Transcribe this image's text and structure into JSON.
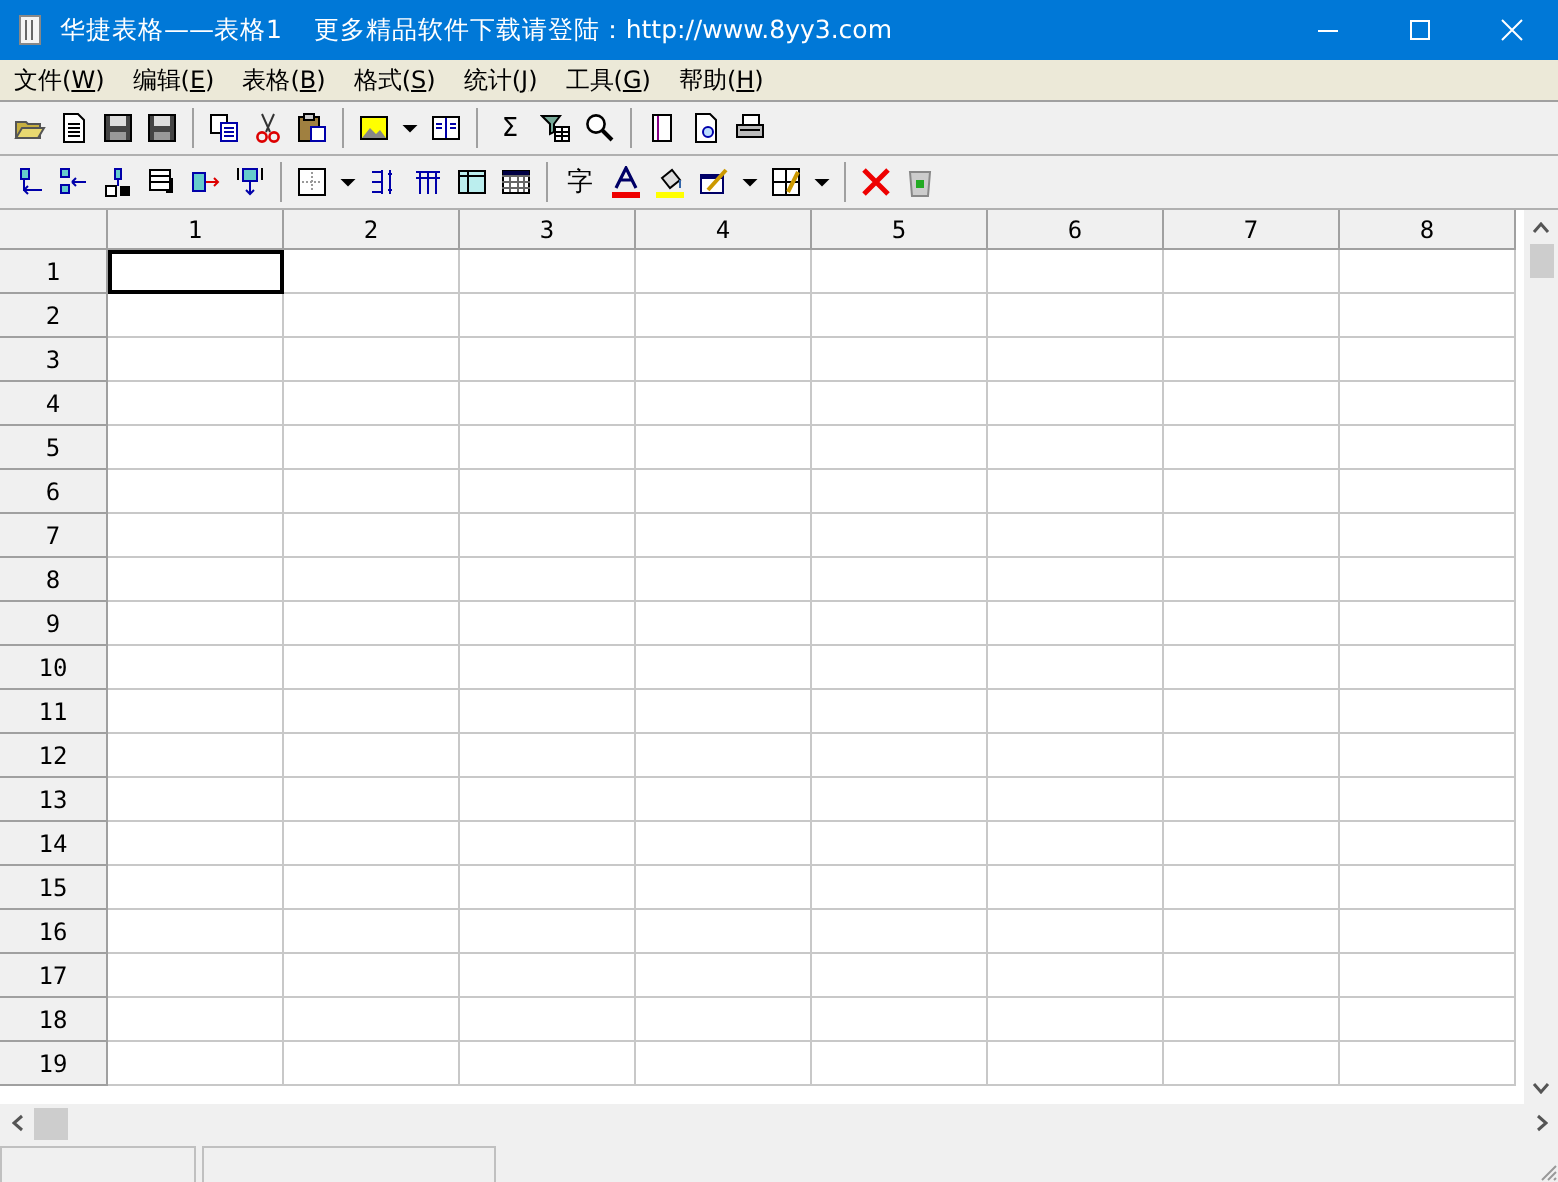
{
  "window": {
    "title": "华捷表格——表格1    更多精品软件下载请登陆：http://www.8yy3.com"
  },
  "menu": [
    {
      "label": "文件(W)"
    },
    {
      "label": "编辑(E)"
    },
    {
      "label": "表格(B)"
    },
    {
      "label": "格式(S)"
    },
    {
      "label": "统计(J)"
    },
    {
      "label": "工具(G)"
    },
    {
      "label": "帮助(H)"
    }
  ],
  "toolbar_glyphs": {
    "sum": "Σ",
    "character": "字"
  },
  "table": {
    "columns": [
      {
        "label": "1"
      },
      {
        "label": "2"
      },
      {
        "label": "3"
      },
      {
        "label": "4"
      },
      {
        "label": "5"
      },
      {
        "label": "6"
      },
      {
        "label": "7"
      },
      {
        "label": "8"
      }
    ],
    "rows": [
      {
        "label": "1",
        "cells": [
          {
            "selected": true
          },
          {
            "selected": false
          },
          {
            "selected": false
          },
          {
            "selected": false
          },
          {
            "selected": false
          },
          {
            "selected": false
          },
          {
            "selected": false
          },
          {
            "selected": false
          }
        ]
      },
      {
        "label": "2",
        "cells": [
          {
            "selected": false
          },
          {
            "selected": false
          },
          {
            "selected": false
          },
          {
            "selected": false
          },
          {
            "selected": false
          },
          {
            "selected": false
          },
          {
            "selected": false
          },
          {
            "selected": false
          }
        ]
      },
      {
        "label": "3",
        "cells": [
          {
            "selected": false
          },
          {
            "selected": false
          },
          {
            "selected": false
          },
          {
            "selected": false
          },
          {
            "selected": false
          },
          {
            "selected": false
          },
          {
            "selected": false
          },
          {
            "selected": false
          }
        ]
      },
      {
        "label": "4",
        "cells": [
          {
            "selected": false
          },
          {
            "selected": false
          },
          {
            "selected": false
          },
          {
            "selected": false
          },
          {
            "selected": false
          },
          {
            "selected": false
          },
          {
            "selected": false
          },
          {
            "selected": false
          }
        ]
      },
      {
        "label": "5",
        "cells": [
          {
            "selected": false
          },
          {
            "selected": false
          },
          {
            "selected": false
          },
          {
            "selected": false
          },
          {
            "selected": false
          },
          {
            "selected": false
          },
          {
            "selected": false
          },
          {
            "selected": false
          }
        ]
      },
      {
        "label": "6",
        "cells": [
          {
            "selected": false
          },
          {
            "selected": false
          },
          {
            "selected": false
          },
          {
            "selected": false
          },
          {
            "selected": false
          },
          {
            "selected": false
          },
          {
            "selected": false
          },
          {
            "selected": false
          }
        ]
      },
      {
        "label": "7",
        "cells": [
          {
            "selected": false
          },
          {
            "selected": false
          },
          {
            "selected": false
          },
          {
            "selected": false
          },
          {
            "selected": false
          },
          {
            "selected": false
          },
          {
            "selected": false
          },
          {
            "selected": false
          }
        ]
      },
      {
        "label": "8",
        "cells": [
          {
            "selected": false
          },
          {
            "selected": false
          },
          {
            "selected": false
          },
          {
            "selected": false
          },
          {
            "selected": false
          },
          {
            "selected": false
          },
          {
            "selected": false
          },
          {
            "selected": false
          }
        ]
      },
      {
        "label": "9",
        "cells": [
          {
            "selected": false
          },
          {
            "selected": false
          },
          {
            "selected": false
          },
          {
            "selected": false
          },
          {
            "selected": false
          },
          {
            "selected": false
          },
          {
            "selected": false
          },
          {
            "selected": false
          }
        ]
      },
      {
        "label": "10",
        "cells": [
          {
            "selected": false
          },
          {
            "selected": false
          },
          {
            "selected": false
          },
          {
            "selected": false
          },
          {
            "selected": false
          },
          {
            "selected": false
          },
          {
            "selected": false
          },
          {
            "selected": false
          }
        ]
      },
      {
        "label": "11",
        "cells": [
          {
            "selected": false
          },
          {
            "selected": false
          },
          {
            "selected": false
          },
          {
            "selected": false
          },
          {
            "selected": false
          },
          {
            "selected": false
          },
          {
            "selected": false
          },
          {
            "selected": false
          }
        ]
      },
      {
        "label": "12",
        "cells": [
          {
            "selected": false
          },
          {
            "selected": false
          },
          {
            "selected": false
          },
          {
            "selected": false
          },
          {
            "selected": false
          },
          {
            "selected": false
          },
          {
            "selected": false
          },
          {
            "selected": false
          }
        ]
      },
      {
        "label": "13",
        "cells": [
          {
            "selected": false
          },
          {
            "selected": false
          },
          {
            "selected": false
          },
          {
            "selected": false
          },
          {
            "selected": false
          },
          {
            "selected": false
          },
          {
            "selected": false
          },
          {
            "selected": false
          }
        ]
      },
      {
        "label": "14",
        "cells": [
          {
            "selected": false
          },
          {
            "selected": false
          },
          {
            "selected": false
          },
          {
            "selected": false
          },
          {
            "selected": false
          },
          {
            "selected": false
          },
          {
            "selected": false
          },
          {
            "selected": false
          }
        ]
      },
      {
        "label": "15",
        "cells": [
          {
            "selected": false
          },
          {
            "selected": false
          },
          {
            "selected": false
          },
          {
            "selected": false
          },
          {
            "selected": false
          },
          {
            "selected": false
          },
          {
            "selected": false
          },
          {
            "selected": false
          }
        ]
      },
      {
        "label": "16",
        "cells": [
          {
            "selected": false
          },
          {
            "selected": false
          },
          {
            "selected": false
          },
          {
            "selected": false
          },
          {
            "selected": false
          },
          {
            "selected": false
          },
          {
            "selected": false
          },
          {
            "selected": false
          }
        ]
      },
      {
        "label": "17",
        "cells": [
          {
            "selected": false
          },
          {
            "selected": false
          },
          {
            "selected": false
          },
          {
            "selected": false
          },
          {
            "selected": false
          },
          {
            "selected": false
          },
          {
            "selected": false
          },
          {
            "selected": false
          }
        ]
      },
      {
        "label": "18",
        "cells": [
          {
            "selected": false
          },
          {
            "selected": false
          },
          {
            "selected": false
          },
          {
            "selected": false
          },
          {
            "selected": false
          },
          {
            "selected": false
          },
          {
            "selected": false
          },
          {
            "selected": false
          }
        ]
      },
      {
        "label": "19",
        "cells": [
          {
            "selected": false
          },
          {
            "selected": false
          },
          {
            "selected": false
          },
          {
            "selected": false
          },
          {
            "selected": false
          },
          {
            "selected": false
          },
          {
            "selected": false
          },
          {
            "selected": false
          }
        ]
      }
    ]
  }
}
